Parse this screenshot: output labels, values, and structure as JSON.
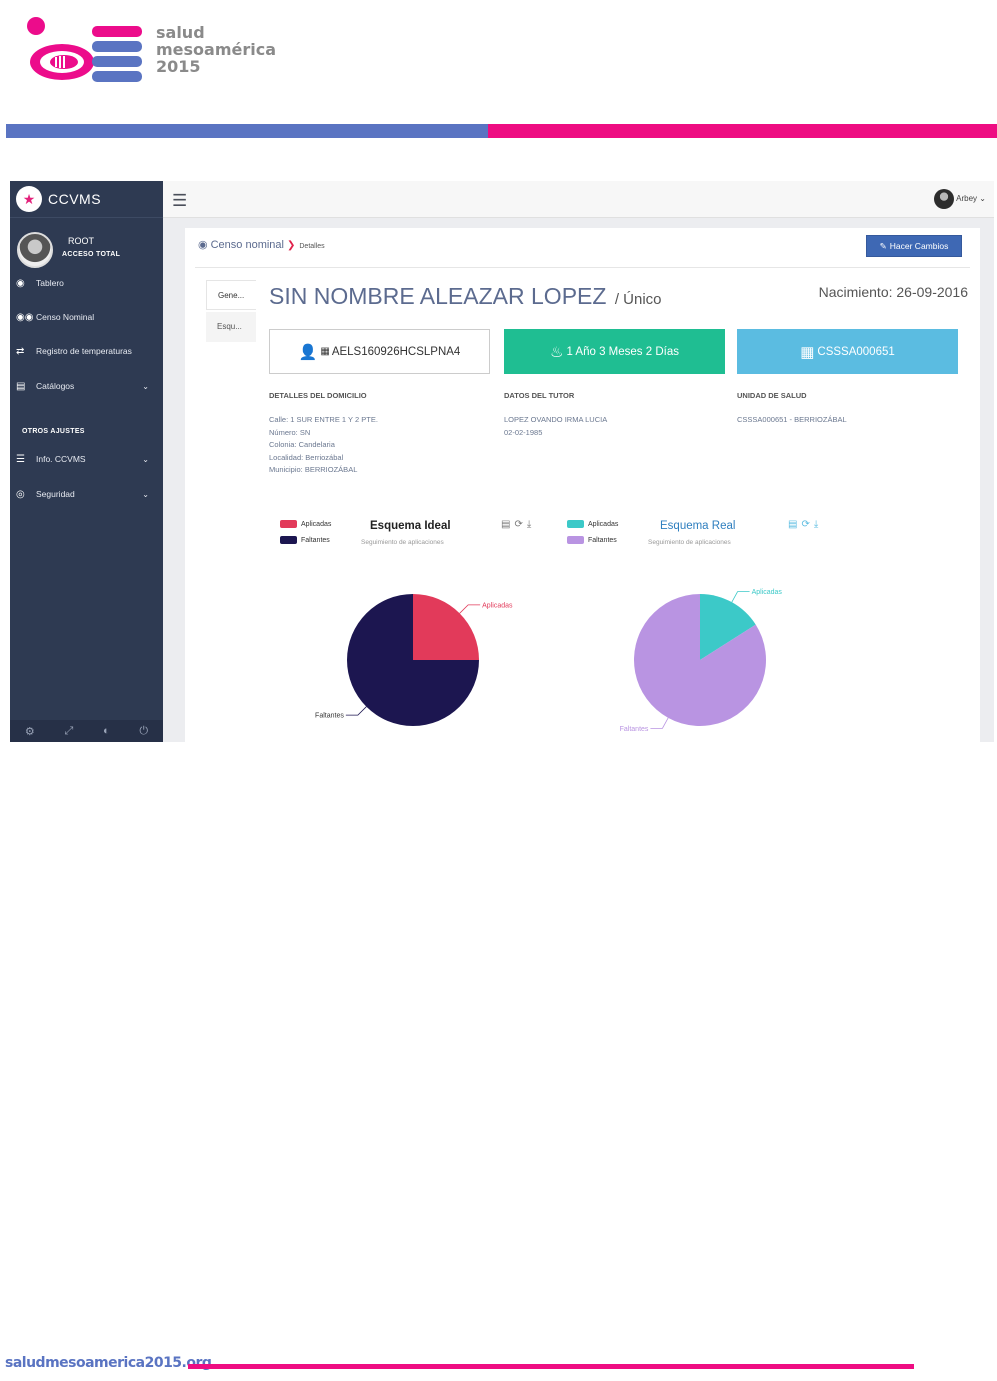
{
  "doc_header": {
    "logo_text": [
      "salud",
      "mesoamérica",
      "2015"
    ],
    "band_colors": [
      "#5a74c2",
      "#ee0d82"
    ]
  },
  "app": {
    "brand": "CCVMS",
    "user": {
      "name": "ROOT",
      "role": "ACCESO TOTAL"
    },
    "nav": [
      {
        "label": "Tablero",
        "icon": "dashboard-icon",
        "glyph": "◉"
      },
      {
        "label": "Censo Nominal",
        "icon": "users-icon",
        "glyph": "👥"
      },
      {
        "label": "Registro de temperaturas",
        "icon": "share-icon",
        "glyph": "⇄"
      },
      {
        "label": "Catálogos",
        "icon": "archive-icon",
        "glyph": "▤",
        "has_children": true
      }
    ],
    "nav_section_header": "OTROS AJUSTES",
    "nav_extra": [
      {
        "label": "Info. CCVMS",
        "icon": "server-icon",
        "glyph": "☰",
        "has_children": true
      },
      {
        "label": "Seguridad",
        "icon": "accessibility-icon",
        "glyph": "◎",
        "has_children": true
      }
    ],
    "footer_icons": [
      "gear-icon",
      "fullscreen-icon",
      "eye-slash-icon",
      "power-icon"
    ],
    "topbar_user": "Arbey"
  },
  "page": {
    "breadcrumb": {
      "section": "Censo nominal",
      "current": "Detalles"
    },
    "edit_button": "Hacer Cambios",
    "tabs": [
      "Gene...",
      "Esqu..."
    ],
    "patient": {
      "name": "SIN NOMBRE ALEAZAR LOPEZ",
      "name_suffix": "/ Único",
      "birth": "Nacimiento: 26-09-2016"
    },
    "boxes": {
      "curp": "AELS160926HCSLPNA4",
      "age": "1 Año 3 Meses 2 Días",
      "unit": "CSSSA000651",
      "colors": {
        "curp": "#ffffff",
        "age": "#1fbe92",
        "unit": "#5bbce1"
      }
    },
    "sections": {
      "domicilio": {
        "title": "DETALLES DEL DOMICILIO",
        "lines": [
          "Calle: 1 SUR ENTRE 1 Y 2 PTE.",
          "Número: SN",
          "Colonia: Candelaria",
          "Localidad: Berriozábal",
          "Municipio: BERRIOZÁBAL"
        ]
      },
      "tutor": {
        "title": "DATOS DEL TUTOR",
        "lines": [
          "LOPEZ OVANDO IRMA LUCIA",
          "02-02-1985"
        ]
      },
      "unidad": {
        "title": "UNIDAD DE SALUD",
        "lines": [
          "CSSSA000651 - BERRIOZÁBAL"
        ]
      }
    }
  },
  "chart_data": [
    {
      "type": "pie",
      "title": "Esquema Ideal",
      "subtitle": "Seguimiento de aplicaciones",
      "categories": [
        "Aplicadas",
        "Faltantes"
      ],
      "values": [
        25,
        75
      ],
      "colors": [
        "#e23a5a",
        "#1c1650"
      ],
      "title_color": "#222222",
      "legend": "top-left"
    },
    {
      "type": "pie",
      "title": "Esquema Real",
      "subtitle": "Seguimiento de aplicaciones",
      "categories": [
        "Aplicadas",
        "Faltantes"
      ],
      "values": [
        16,
        84
      ],
      "colors": [
        "#3cc9c8",
        "#b994e2"
      ],
      "title_color": "#2f7fbf",
      "legend": "top-left"
    }
  ],
  "footer": {
    "site": "saludmesoamerica2015.org"
  }
}
